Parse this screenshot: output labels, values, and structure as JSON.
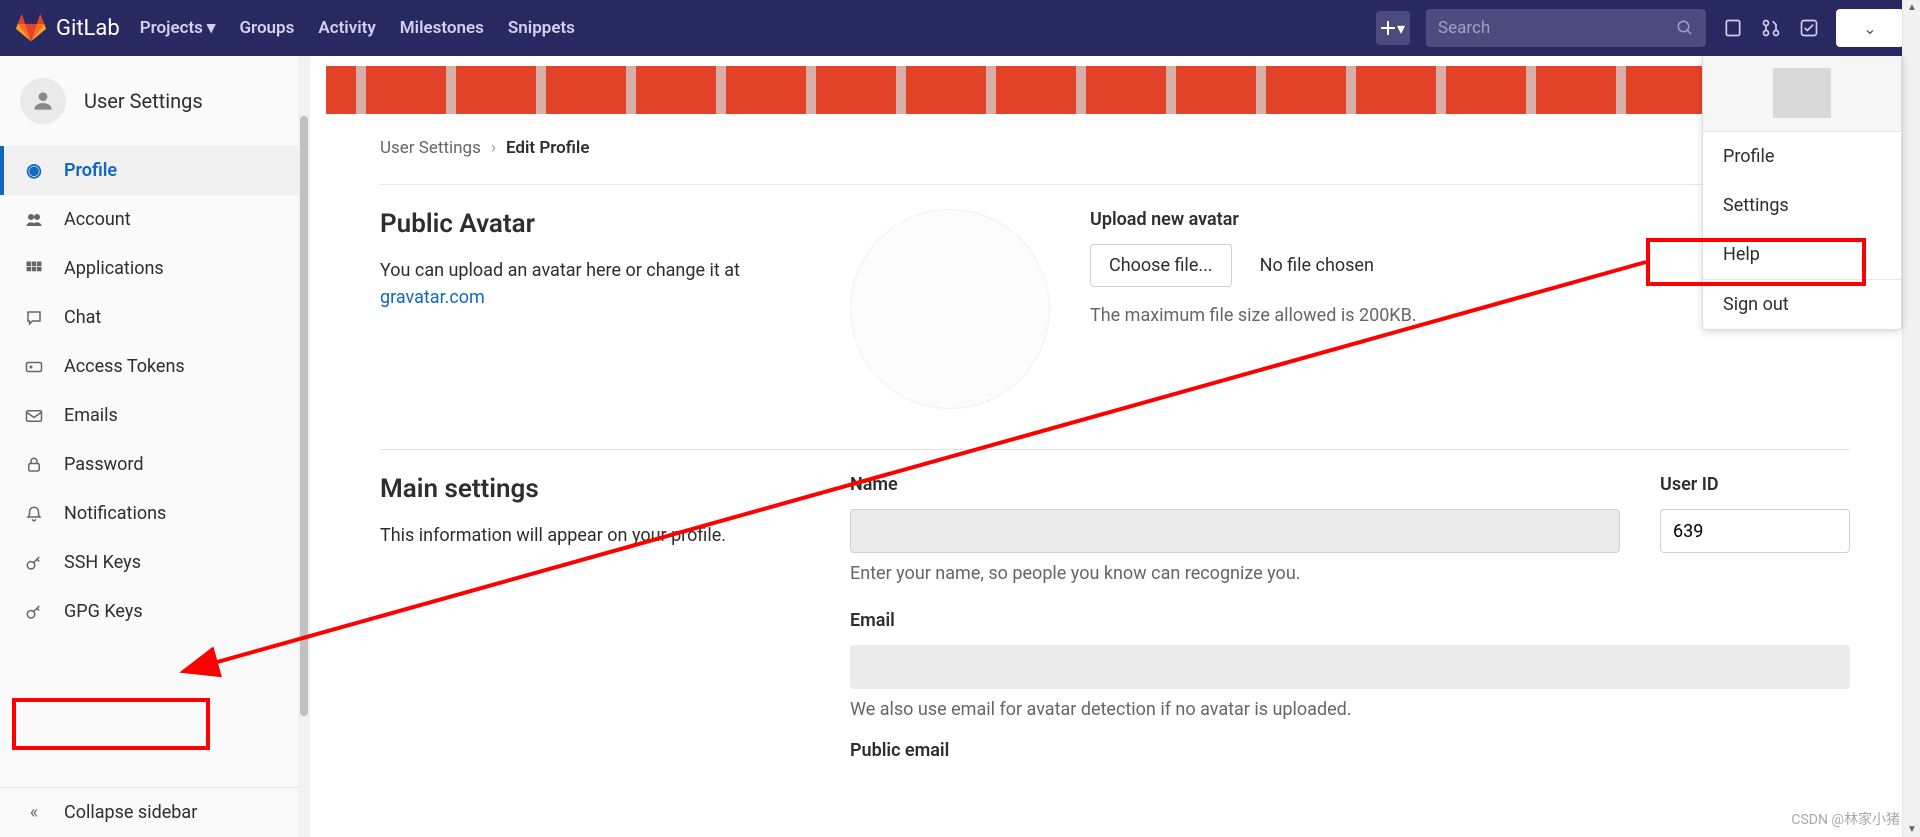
{
  "brand": "GitLab",
  "nav": {
    "projects": "Projects",
    "groups": "Groups",
    "activity": "Activity",
    "milestones": "Milestones",
    "snippets": "Snippets"
  },
  "search": {
    "placeholder": "Search"
  },
  "sidebar": {
    "title": "User Settings",
    "items": [
      {
        "label": "Profile",
        "icon": "profile"
      },
      {
        "label": "Account",
        "icon": "account"
      },
      {
        "label": "Applications",
        "icon": "apps"
      },
      {
        "label": "Chat",
        "icon": "chat"
      },
      {
        "label": "Access Tokens",
        "icon": "token"
      },
      {
        "label": "Emails",
        "icon": "mail"
      },
      {
        "label": "Password",
        "icon": "lock"
      },
      {
        "label": "Notifications",
        "icon": "bell"
      },
      {
        "label": "SSH Keys",
        "icon": "key"
      },
      {
        "label": "GPG Keys",
        "icon": "key"
      }
    ],
    "collapse": "Collapse sidebar"
  },
  "breadcrumb": {
    "root": "User Settings",
    "current": "Edit Profile"
  },
  "avatar": {
    "title": "Public Avatar",
    "desc": "You can upload an avatar here or change it at ",
    "link": "gravatar.com",
    "upload_label": "Upload new avatar",
    "choose": "Choose file...",
    "status": "No file chosen",
    "hint": "The maximum file size allowed is 200KB."
  },
  "profile": {
    "title": "Main settings",
    "desc": "This information will appear on your profile.",
    "name_label": "Name",
    "name_help": "Enter your name, so people you know can recognize you.",
    "userid_label": "User ID",
    "userid_value": "639",
    "email_label": "Email",
    "email_help": "We also use email for avatar detection if no avatar is uploaded.",
    "public_email_label": "Public email"
  },
  "dropdown": {
    "profile": "Profile",
    "settings": "Settings",
    "help": "Help",
    "signout": "Sign out"
  },
  "watermark": "CSDN @林家小猪"
}
